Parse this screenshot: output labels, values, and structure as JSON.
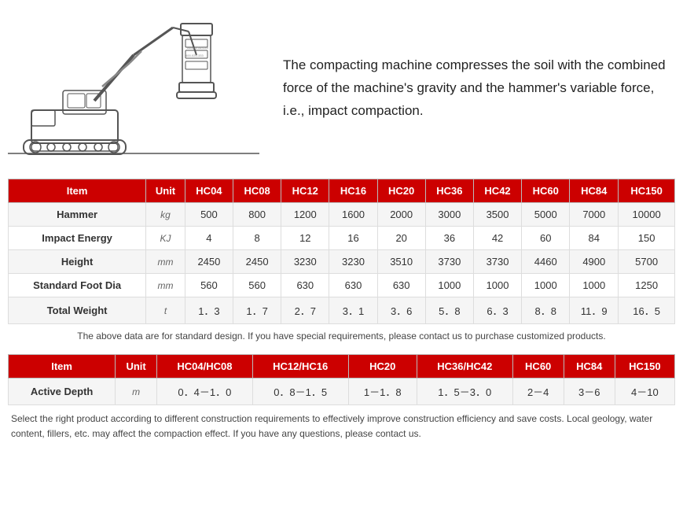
{
  "description": "The compacting machine compresses the soil with the combined force of the machine's gravity and the hammer's variable force, i.e., impact compaction.",
  "table1": {
    "headers": [
      "Item",
      "Unit",
      "HC04",
      "HC08",
      "HC12",
      "HC16",
      "HC20",
      "HC36",
      "HC42",
      "HC60",
      "HC84",
      "HC150"
    ],
    "rows": [
      [
        "Hammer",
        "kg",
        "500",
        "800",
        "1200",
        "1600",
        "2000",
        "3000",
        "3500",
        "5000",
        "7000",
        "10000"
      ],
      [
        "Impact Energy",
        "KJ",
        "4",
        "8",
        "12",
        "16",
        "20",
        "36",
        "42",
        "60",
        "84",
        "150"
      ],
      [
        "Height",
        "mm",
        "2450",
        "2450",
        "3230",
        "3230",
        "3510",
        "3730",
        "3730",
        "4460",
        "4900",
        "5700"
      ],
      [
        "Standard Foot Dia",
        "mm",
        "560",
        "560",
        "630",
        "630",
        "630",
        "1000",
        "1000",
        "1000",
        "1000",
        "1250"
      ],
      [
        "Total Weight",
        "t",
        "1．3",
        "1．7",
        "2．7",
        "3．1",
        "3．6",
        "5．8",
        "6．3",
        "8．8",
        "11．9",
        "16．5"
      ]
    ]
  },
  "note1": "The above data are for standard design. If you have special requirements, please contact us to purchase customized products.",
  "table2": {
    "headers": [
      "Item",
      "Unit",
      "HC04/HC08",
      "HC12/HC16",
      "HC20",
      "HC36/HC42",
      "HC60",
      "HC84",
      "HC150"
    ],
    "rows": [
      [
        "Active Depth",
        "m",
        "0．4－1．0",
        "0．8－1．5",
        "1－1．8",
        "1．5－3．0",
        "2－4",
        "3－6",
        "4－10"
      ]
    ]
  },
  "note2": "Select the right product according to different construction requirements to effectively improve construction efficiency and save costs. Local geology, water content, fillers, etc. may affect the compaction effect. If you have any questions, please contact us."
}
